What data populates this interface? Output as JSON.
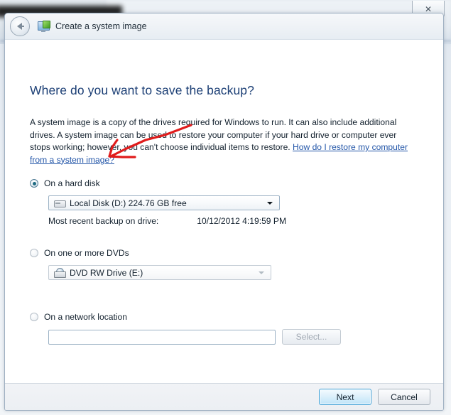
{
  "window": {
    "close_label": "✕",
    "close_icon": "close-icon"
  },
  "titlebar": {
    "back_icon": "back-arrow-icon",
    "app_icon": "system-image-icon",
    "title": "Create a system image"
  },
  "page": {
    "heading": "Where do you want to save the backup?",
    "description_before_link": "A system image is a copy of the drives required for Windows to run. It can also include additional drives. A system image can be used to restore your computer if your hard drive or computer ever stops working; however, you can't choose individual items to restore. ",
    "link_text": "How do I restore my computer from a system image?"
  },
  "options": {
    "hard_disk": {
      "label": "On a hard disk",
      "selected": true,
      "combo_icon": "hard-drive-icon",
      "combo_value": "Local Disk (D:)  224.76 GB free",
      "combo_arrow_icon": "chevron-down-icon",
      "note_label": "Most recent backup on drive:",
      "note_value": "10/12/2012 4:19:59 PM"
    },
    "dvds": {
      "label": "On one or more DVDs",
      "selected": false,
      "combo_icon": "dvd-drive-icon",
      "combo_value": "DVD RW Drive (E:)",
      "combo_arrow_icon": "chevron-down-icon"
    },
    "network": {
      "label": "On a network location",
      "selected": false,
      "input_value": "",
      "input_placeholder": "",
      "select_button_label": "Select..."
    }
  },
  "footer": {
    "next_label": "Next",
    "cancel_label": "Cancel"
  },
  "annotation": {
    "arrow_color": "#e01b1b",
    "arrow_name": "red-annotation-arrow"
  },
  "colors": {
    "heading": "#1c3f75",
    "link": "#2255a8",
    "accent": "#3c9fd6",
    "radio_dot": "#1f6b82"
  }
}
